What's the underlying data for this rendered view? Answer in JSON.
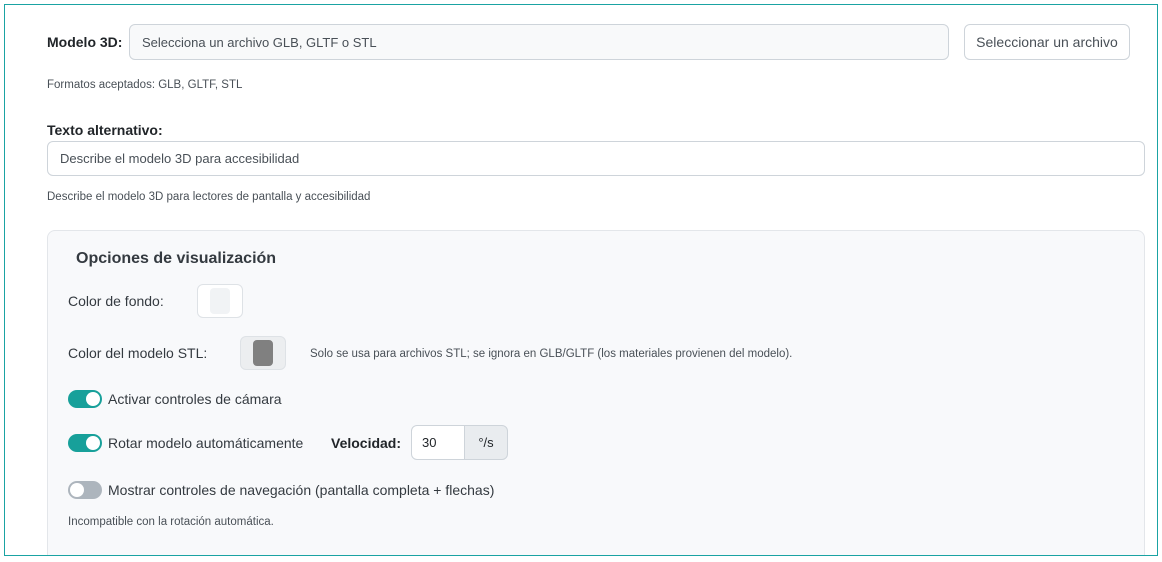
{
  "model": {
    "label": "Modelo 3D:",
    "file_placeholder": "Selecciona un archivo GLB, GLTF o STL",
    "select_button": "Seleccionar un archivo",
    "help": "Formatos aceptados: GLB, GLTF, STL"
  },
  "alt_text": {
    "label": "Texto alternativo:",
    "placeholder": "Describe el modelo 3D para accesibilidad",
    "help": "Describe el modelo 3D para lectores de pantalla y accesibilidad"
  },
  "display_options": {
    "title": "Opciones de visualización",
    "background_color": {
      "label": "Color de fondo:",
      "value": "#f1f3f5"
    },
    "stl_color": {
      "label": "Color del modelo STL:",
      "value": "#808080",
      "help": "Solo se usa para archivos STL; se ignora en GLB/GLTF (los materiales provienen del modelo)."
    },
    "camera_controls": {
      "label": "Activar controles de cámara",
      "checked": true
    },
    "auto_rotate": {
      "label": "Rotar modelo automáticamente",
      "checked": true,
      "speed_label": "Velocidad:",
      "speed_value": "30",
      "speed_unit": "°/s"
    },
    "navigation_controls": {
      "label": "Mostrar controles de navegación (pantalla completa + flechas)",
      "checked": false,
      "help": "Incompatible con la rotación automática."
    }
  },
  "colors": {
    "accent": "#17a09a",
    "frame_border": "#1aa3a3",
    "toggle_off": "#adb5bd"
  }
}
